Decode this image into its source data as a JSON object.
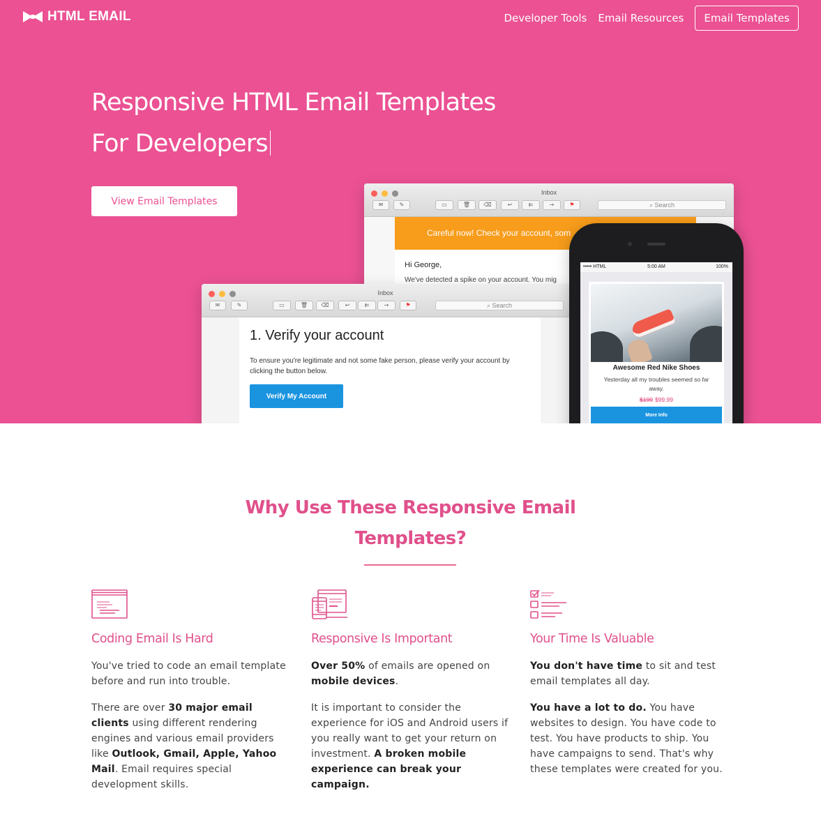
{
  "nav": {
    "brand": "HTML EMAIL",
    "links": [
      "Developer Tools",
      "Email Resources"
    ],
    "cta": "Email Templates"
  },
  "hero": {
    "title_line1": "Responsive HTML Email Templates",
    "title_line2": "For Developers",
    "button": "View Email Templates",
    "background": "#eb5193"
  },
  "mockup": {
    "back_window": {
      "title": "Inbox",
      "search": "Search",
      "alert": "Careful now! Check your account, som",
      "greeting": "Hi George,",
      "partial_line": "We've detected a spike on your account. You mig"
    },
    "front_window": {
      "title": "Inbox",
      "search": "Search",
      "heading": "1. Verify your account",
      "text": "To ensure you're legitimate and not some fake person, please verify your account by clicking the button below.",
      "button": "Verify My Account"
    },
    "phone": {
      "carrier": "HTML",
      "time": "5:00 AM",
      "battery": "100%",
      "product_title": "Awesome Red Nike Shoes",
      "product_desc": "Yesterday all my troubles seemed so far away.",
      "old_price": "$199",
      "new_price": "$99.99",
      "button": "More Info"
    }
  },
  "why": {
    "title_line1": "Why Use These Responsive Email",
    "title_line2": "Templates?",
    "columns": [
      {
        "icon": "code-window-icon",
        "title": "Coding Email Is Hard",
        "p1": "You've tried to code an email template before and run into trouble.",
        "p2_a": "There are over ",
        "p2_b": "30 major email clients",
        "p2_c": " using different rendering engines and various email providers like ",
        "p2_d": "Outlook, Gmail, Apple, Yahoo Mail",
        "p2_e": ". Email requires special development skills."
      },
      {
        "icon": "responsive-devices-icon",
        "title": "Responsive Is Important",
        "p1_a": "Over 50%",
        "p1_b": " of emails are opened on ",
        "p1_c": "mobile devices",
        "p1_d": ".",
        "p2_a": "It is important to consider the experience for iOS and Android users if you really want to get your return on investment. ",
        "p2_b": "A broken mobile experience can break your campaign."
      },
      {
        "icon": "checklist-icon",
        "title": "Your Time Is Valuable",
        "p1_a": "You don't have time",
        "p1_b": " to sit and test email templates all day.",
        "p2_a": "You have a lot to do.",
        "p2_b": " You have websites to design. You have code to test. You have products to ship. You have campaigns to send. That's why these templates were created for you."
      }
    ]
  },
  "colors": {
    "brand_pink": "#eb5193",
    "heading_pink": "#e0508b",
    "alert_orange": "#f79c1b",
    "button_blue": "#1b94e0"
  }
}
